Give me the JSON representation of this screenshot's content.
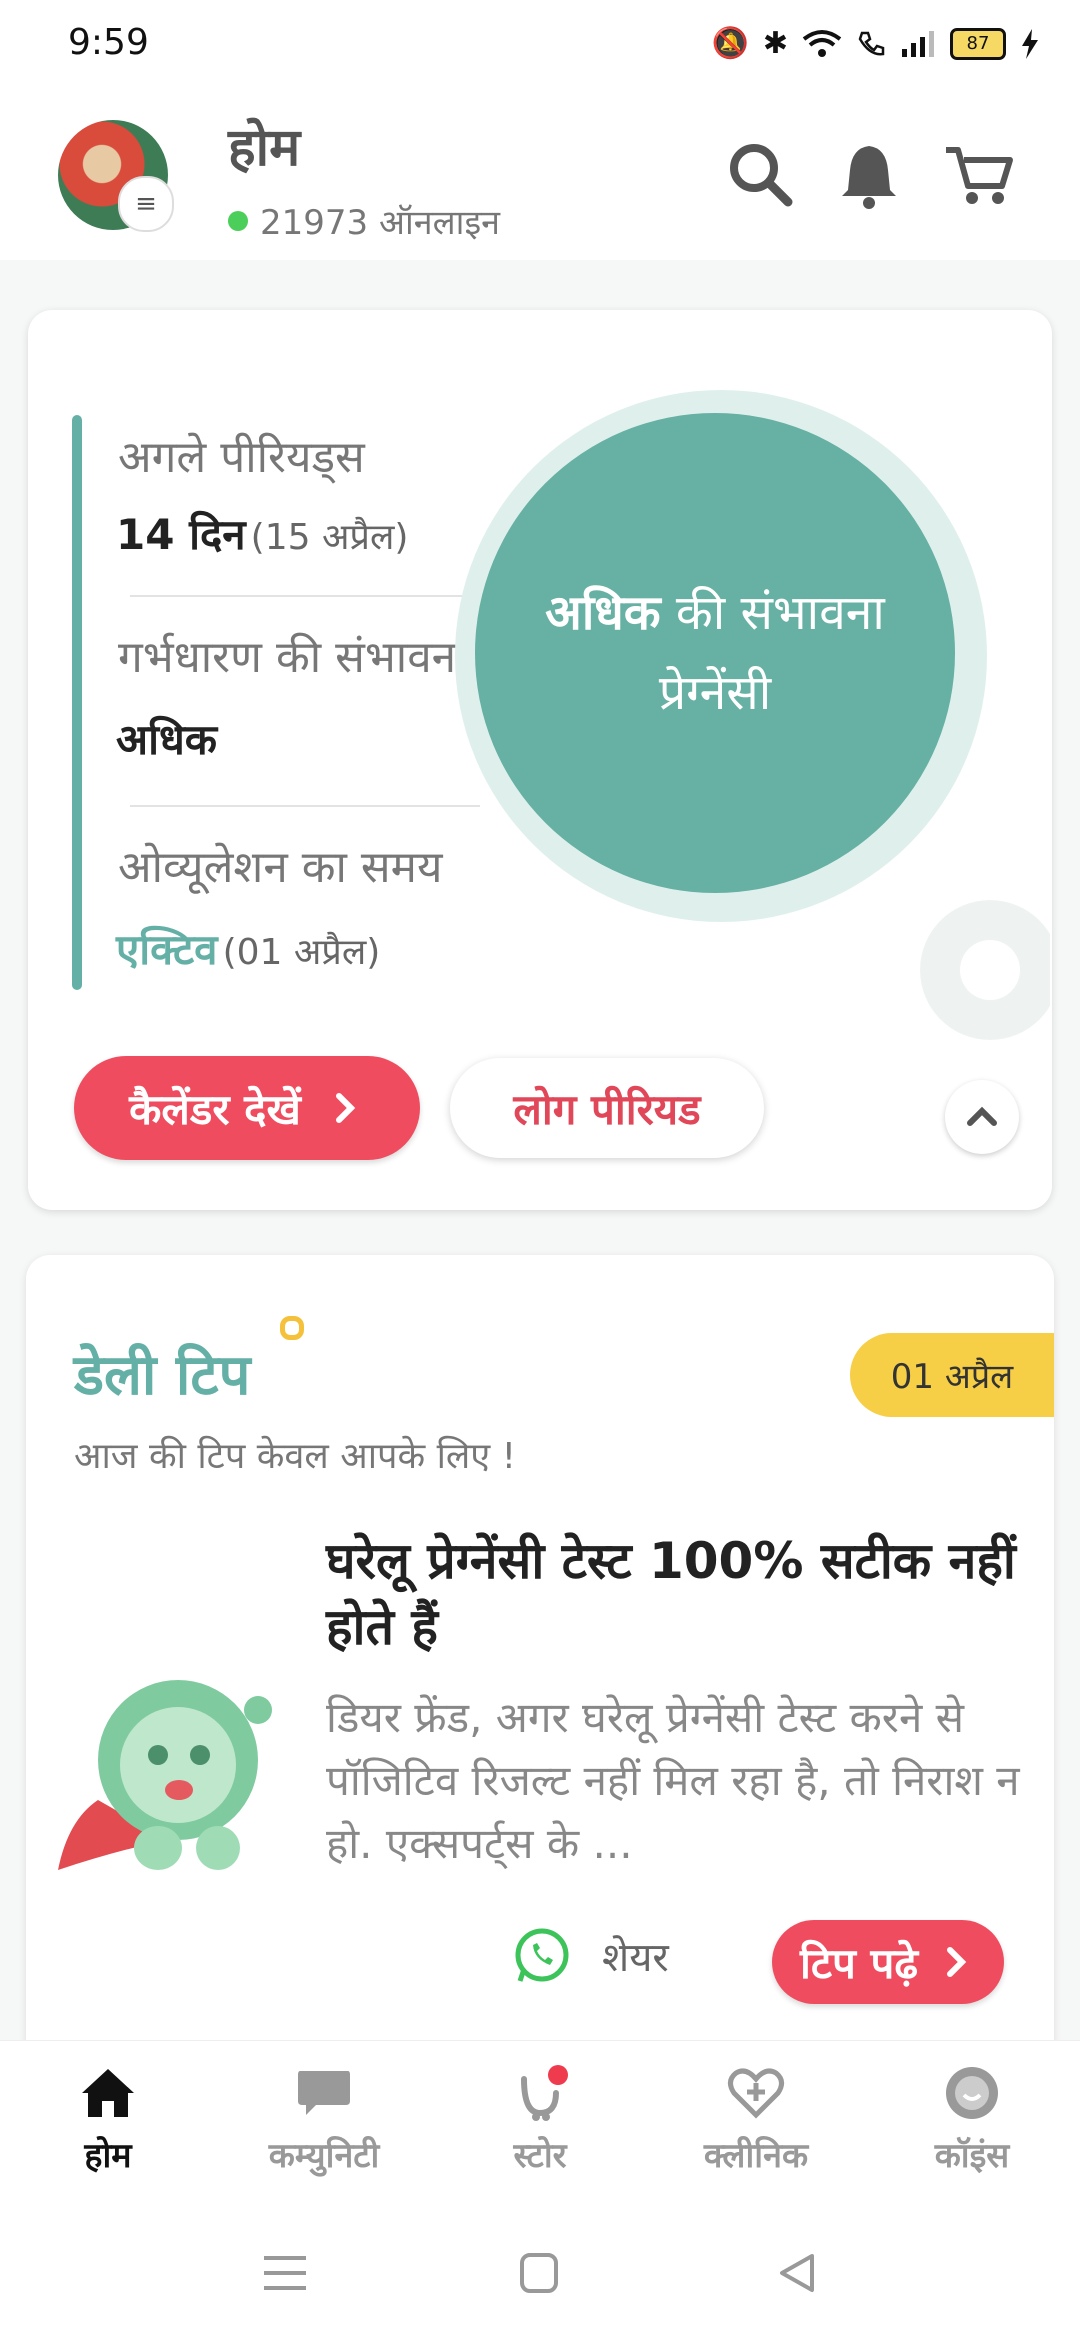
{
  "status_bar": {
    "time": "9:59",
    "battery": "87"
  },
  "header": {
    "title": "होम",
    "online_text": "21973 ऑनलाइन"
  },
  "cycle": {
    "next_period_label": "अगले पीरियड्स",
    "next_period_value": "14 दिन",
    "next_period_date": "(15 अप्रैल)",
    "conception_label": "गर्भधारण की संभावना",
    "conception_value": "अधिक",
    "ovulation_label": "ओव्यूलेशन का समय",
    "ovulation_value": "एक्टिव",
    "ovulation_date": "(01 अप्रैल)",
    "circle_bold": "अधिक",
    "circle_rest": " की संभावना",
    "circle_line2": "प्रेग्नेंसी",
    "calendar_button": "कैलेंडर देखें",
    "log_button": "लोग पीरियड"
  },
  "tip": {
    "title": "डेली टिप",
    "date": "01 अप्रैल",
    "subtitle": "आज की टिप केवल आपके लिए !",
    "headline": "घरेलू प्रेग्नेंसी टेस्ट 100% सटीक नहीं होते हैं",
    "body": "डियर फ्रेंड, अगर घरेलू प्रेग्नेंसी टेस्ट करने से पॉजिटिव रिजल्ट नहीं मिल रहा है, तो निराश न हो. एक्सपर्ट्स के ...",
    "share_label": "शेयर",
    "read_button": "टिप पढ़े"
  },
  "nav": [
    {
      "label": "होम",
      "icon": "home-icon"
    },
    {
      "label": "कम्युनिटी",
      "icon": "chat-icon"
    },
    {
      "label": "स्टोर",
      "icon": "store-icon"
    },
    {
      "label": "क्लीनिक",
      "icon": "heart-plus-icon"
    },
    {
      "label": "कॉइंस",
      "icon": "coin-icon"
    }
  ],
  "colors": {
    "teal": "#64b0a6",
    "red": "#ef4d5f",
    "yellow": "#f6cf47"
  }
}
